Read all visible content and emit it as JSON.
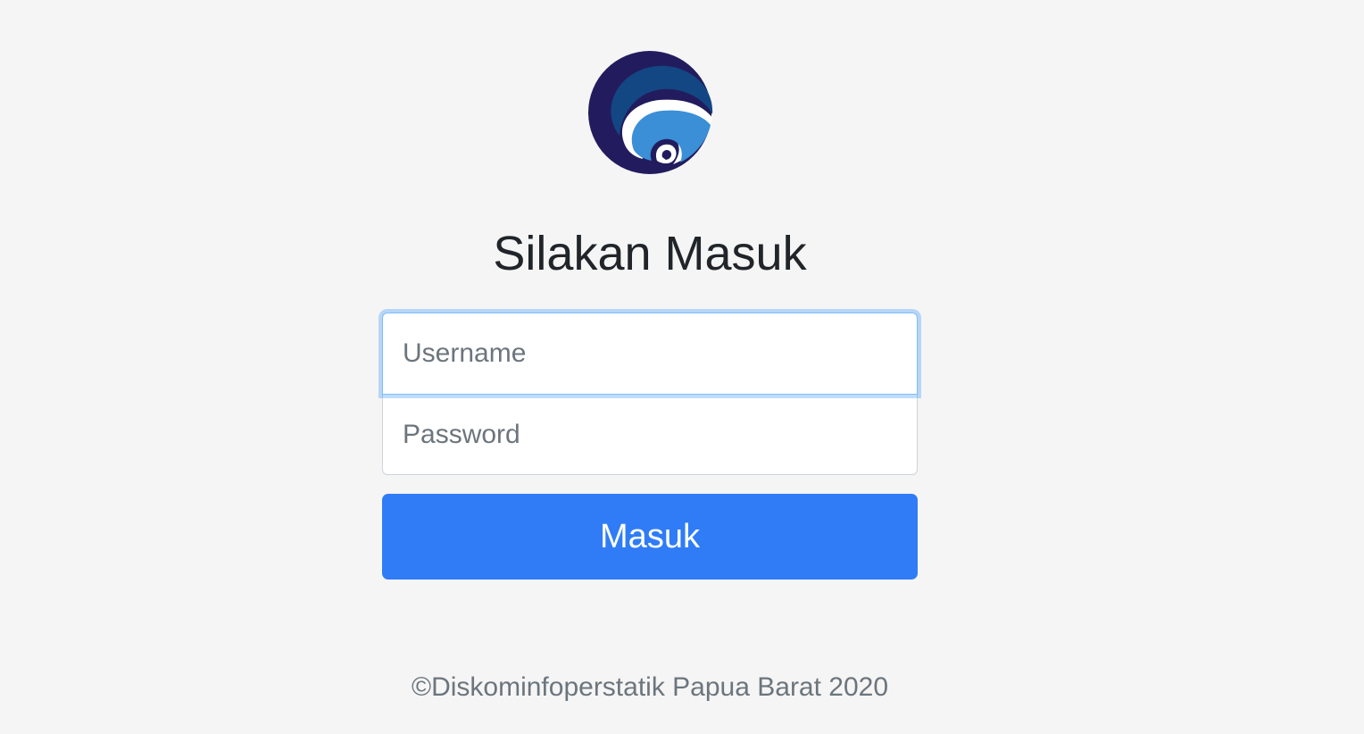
{
  "logo": {
    "icon": "kominfo-logo-icon",
    "colors": [
      "#221c5e",
      "#134783",
      "#3a8fd6"
    ]
  },
  "heading": "Silakan Masuk",
  "form": {
    "username_placeholder": "Username",
    "password_placeholder": "Password",
    "submit_label": "Masuk"
  },
  "footer": "©Diskominfoperstatik Papua Barat 2020",
  "colors": {
    "background": "#f5f5f5",
    "primary": "#2f7cf6",
    "focus_ring": "#80bdff"
  }
}
